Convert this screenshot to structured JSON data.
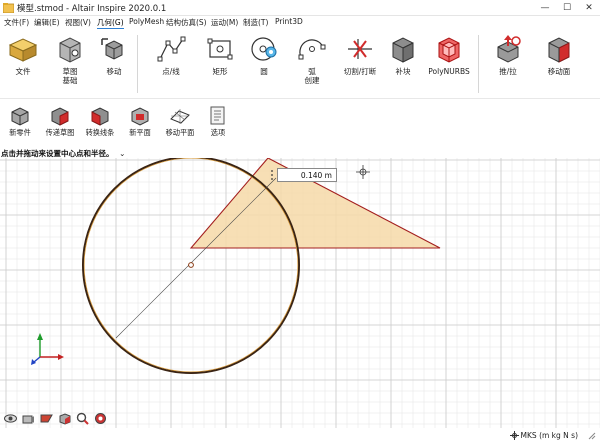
{
  "window": {
    "title": "模型.stmod - Altair Inspire 2020.0.1",
    "min_glyph": "—",
    "max_glyph": "☐",
    "close_glyph": "✕"
  },
  "menu": [
    "文件(F)",
    "编辑(E)",
    "视图(V)",
    "几何(G)",
    "PolyMesh",
    "结构仿真(S)",
    "运动(M)",
    "制造(T)",
    "Print3D"
  ],
  "ribbon": {
    "buttons": [
      {
        "label": "文件",
        "icon": "file-icon"
      },
      {
        "label": "草图\n基础",
        "icon": "sketch-basics-icon"
      },
      {
        "label": "移动",
        "icon": "move-icon"
      },
      {
        "label": "点/线",
        "icon": "point-line-icon"
      },
      {
        "label": "矩形",
        "icon": "rectangle-icon"
      },
      {
        "label": "圆",
        "icon": "circle-icon"
      },
      {
        "label": "弧\n创建",
        "icon": "arc-icon"
      },
      {
        "label": "切割/打断",
        "icon": "cut-break-icon"
      },
      {
        "label": "补块",
        "icon": "patch-icon"
      },
      {
        "label": "PolyNURBS",
        "icon": "polynurbs-icon"
      },
      {
        "label": "推/拉",
        "icon": "push-pull-icon"
      },
      {
        "label": "移动面",
        "icon": "move-face-icon"
      }
    ]
  },
  "sketch_tools": [
    {
      "label": "新零件",
      "icon": "new-part-icon"
    },
    {
      "label": "传递草图",
      "icon": "transfer-sketch-icon"
    },
    {
      "label": "转换线条",
      "icon": "convert-lines-icon"
    },
    {
      "label": "新平面",
      "icon": "new-plane-icon"
    },
    {
      "label": "移动平面",
      "icon": "move-plane-icon"
    },
    {
      "label": "选项",
      "icon": "options-icon"
    }
  ],
  "hint": "点击并拖动来设置中心点和半径。",
  "hint_chevron": "⌄",
  "dimension_input": {
    "value": "0.140 m"
  },
  "status": {
    "units": "MKS (m kg N s)"
  },
  "colors": {
    "accent_blue": "#2d7fd3",
    "triangle_fill": "#f6d9a8",
    "triangle_stroke": "#a31f1f",
    "circle_stroke": "#3a2414",
    "grid_minor": "#e2e2e2",
    "grid_major": "#c8c8c8"
  }
}
